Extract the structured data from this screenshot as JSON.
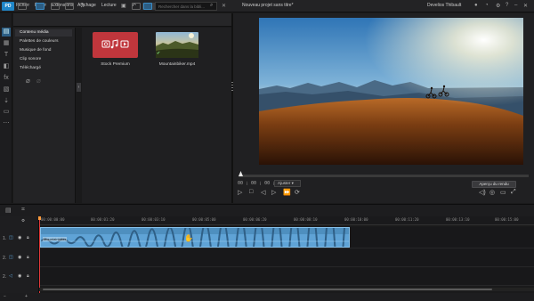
{
  "app": {
    "logo_text": "PD",
    "project_title": "Nouveau projet sans titre*",
    "user_name": "Develios Thibault"
  },
  "menu": [
    "Fichier",
    "Éditer",
    "Extensions",
    "Affichage",
    "Lecture"
  ],
  "toolbar": {
    "produce_label": "Produire"
  },
  "library": {
    "search_placeholder": "Rechercher dans la bibli...",
    "categories": [
      "Contenu média",
      "Palettes de couleurs",
      "Musique de fond",
      "Clip sonore",
      "Téléchargé"
    ],
    "items": [
      {
        "name": "Stock Premium"
      },
      {
        "name": "Mountainbiker.mp4"
      }
    ]
  },
  "preview": {
    "timecode": "00 ; 00 ; 00 ; 00",
    "fit_option": "Ajuster",
    "render_button": "Aperçu du rendu"
  },
  "timeline": {
    "ruler_ticks": [
      "00:00:00:00",
      "00:00:01:20",
      "00:00:03:10",
      "00:00:05:00",
      "00:00:06:20",
      "00:00:08:10",
      "00:00:10:00",
      "00:00:11:20",
      "00:00:13:10",
      "00:00:15:00"
    ],
    "tracks": [
      {
        "label": "1."
      },
      {
        "label": "2."
      },
      {
        "label": "2."
      }
    ],
    "clip_label": "Mountainbiker"
  },
  "colors": {
    "accent": "#1f86c8",
    "clip": "#5fa3d6",
    "stock_tile": "#c0363c",
    "playhead": "#e23a3a"
  }
}
